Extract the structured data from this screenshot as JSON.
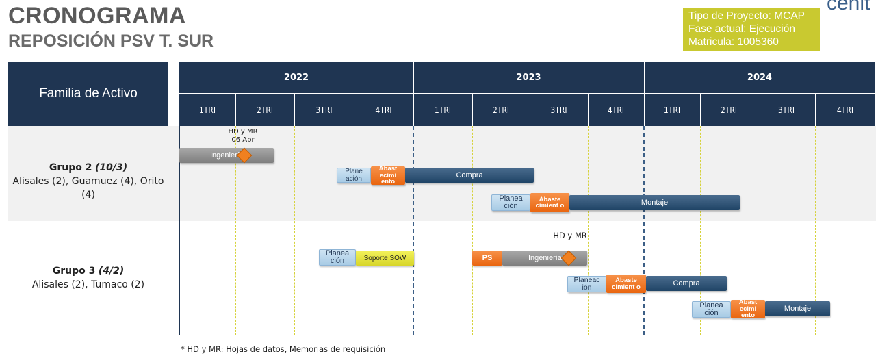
{
  "title": "CRONOGRAMA",
  "subtitle": "REPOSICIÓN PSV T. SUR",
  "info": {
    "line1": "Tipo de Proyecto: MCAP",
    "line2": "Fase actual: Ejecución",
    "line3": "Matricula: 1005360"
  },
  "logo_text": "cenit",
  "table": {
    "header_label": "Familia de Activo",
    "years": [
      "2022",
      "2023",
      "2024"
    ],
    "quarters": [
      "1TRI",
      "2TRI",
      "3TRI",
      "4TRI",
      "1TRI",
      "2TRI",
      "3TRI",
      "4TRI",
      "1TRI",
      "2TRI",
      "3TRI",
      "4TRI"
    ]
  },
  "groups": [
    {
      "name": "Grupo 2",
      "code": "(10/3)",
      "detail": "Alisales (2), Guamuez (4), Orito (4)"
    },
    {
      "name": "Grupo 3",
      "code": "(4/2)",
      "detail": "Alisales (2), Tumaco (2)"
    }
  ],
  "tasks": {
    "g2_ingenieria": "Ingeniería",
    "g2_planeacion1": "Plane ación",
    "g2_abastecimiento1": "Abast ecimi ento",
    "g2_compra": "Compra",
    "g2_planeacion2": "Planea ción",
    "g2_abastecimiento2": "Abaste cimient o",
    "g2_montaje": "Montaje",
    "g3_planeacion1": "Planea ción",
    "g3_soporte": "Soporte SOW",
    "g3_ps": "PS",
    "g3_ingenieria": "Ingeniería",
    "g3_planeacion2": "Planeac ión",
    "g3_abastecimiento2": "Abaste cimient o",
    "g3_compra": "Compra",
    "g3_planeacion3": "Planea ción",
    "g3_abastecimiento3": "Abast ecimi ento",
    "g3_montaje": "Montaje"
  },
  "milestones": {
    "g2_note": "HD y MR 06 Abr",
    "g3_note": "HD y MR"
  },
  "colors": {
    "header": "#1f3552",
    "info_box": "#c9c930",
    "planeacion": "#a8cbe5",
    "abastecimiento": "#e9650f",
    "compra_montaje": "#1f4466",
    "ingenieria": "#7e7e7e",
    "soporte": "#d7d52a",
    "milestone": "#f08020"
  },
  "footnote": "* HD y MR: Hojas de datos, Memorias de requisición"
}
